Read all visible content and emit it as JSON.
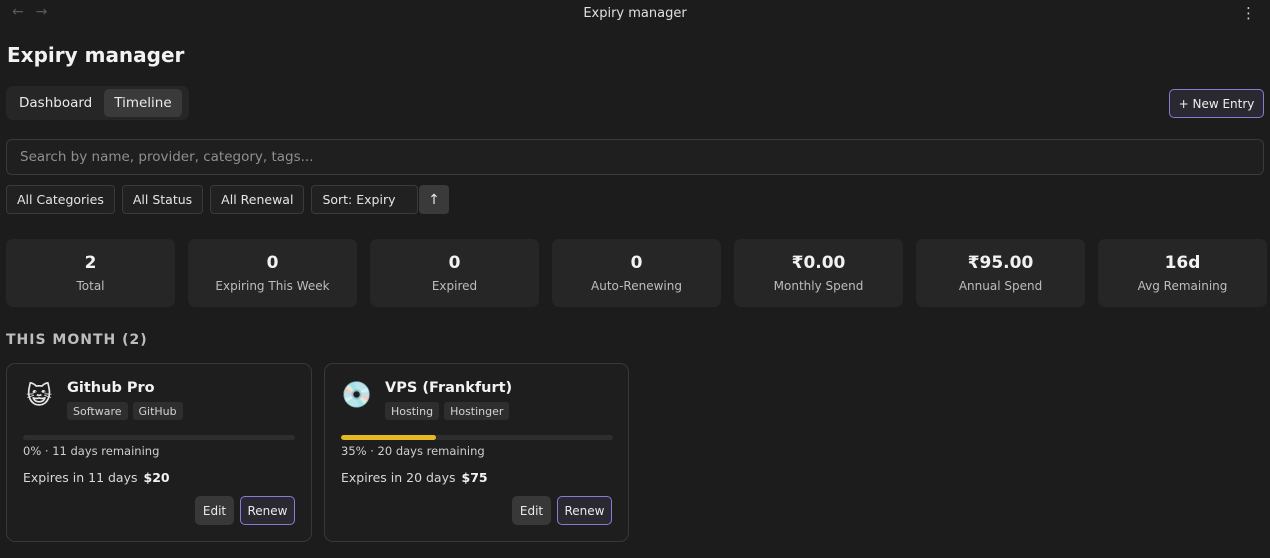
{
  "window": {
    "title": "Expiry manager",
    "back_icon": "arrow-left",
    "forward_icon": "arrow-right",
    "menu_icon": "vertical-ellipsis"
  },
  "page": {
    "title": "Expiry manager"
  },
  "tabs": [
    {
      "label": "Dashboard",
      "active": false
    },
    {
      "label": "Timeline",
      "active": true
    }
  ],
  "new_entry_label": "+ New Entry",
  "search": {
    "placeholder": "Search by name, provider, category, tags...",
    "value": ""
  },
  "filters": {
    "category": "All Categories",
    "status": "All Status",
    "renewal": "All Renewal",
    "sort": "Sort: Expiry",
    "sort_direction_icon": "↑"
  },
  "stats": [
    {
      "value": "2",
      "label": "Total"
    },
    {
      "value": "0",
      "label": "Expiring This Week"
    },
    {
      "value": "0",
      "label": "Expired"
    },
    {
      "value": "0",
      "label": "Auto-Renewing"
    },
    {
      "value": "₹0.00",
      "label": "Monthly Spend"
    },
    {
      "value": "₹95.00",
      "label": "Annual Spend"
    },
    {
      "value": "16d",
      "label": "Avg Remaining"
    }
  ],
  "section": {
    "title": "THIS MONTH (2)"
  },
  "entries": [
    {
      "icon": "😺",
      "name": "Github Pro",
      "tags": [
        "Software",
        "GitHub"
      ],
      "progress": 0,
      "progress_text": "0% · 11 days remaining",
      "expires_text": "Expires in 11 days",
      "price": "$20",
      "edit_label": "Edit",
      "renew_label": "Renew"
    },
    {
      "icon": "💿",
      "name": "VPS (Frankfurt)",
      "tags": [
        "Hosting",
        "Hostinger"
      ],
      "progress": 35,
      "progress_text": "35% · 20 days remaining",
      "expires_text": "Expires in 20 days",
      "price": "$75",
      "edit_label": "Edit",
      "renew_label": "Renew"
    }
  ],
  "colors": {
    "accent": "#8a7ad6",
    "progress": "#e8b824",
    "background": "#1c1c1c"
  }
}
